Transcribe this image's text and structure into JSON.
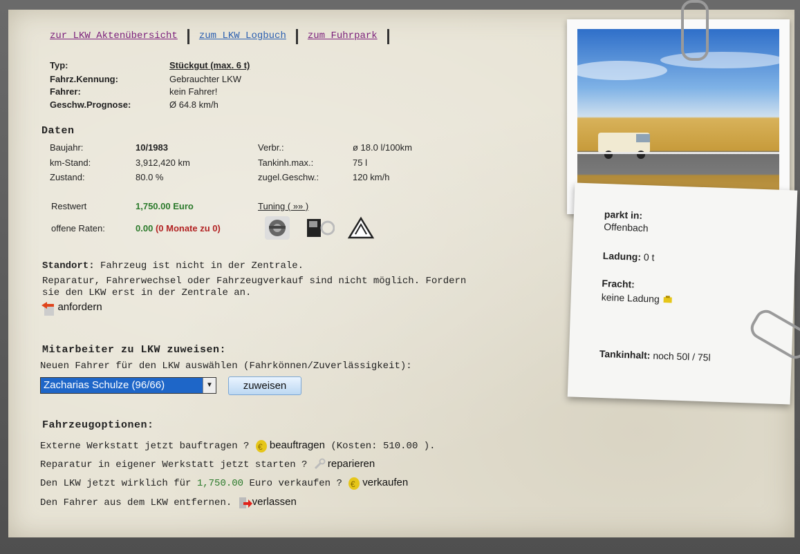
{
  "tabs": {
    "akten": "zur LKW Aktenübersicht",
    "logbuch": "zum LKW Logbuch",
    "fuhrpark": "zum Fuhrpark"
  },
  "info": {
    "typ_label": "Typ:",
    "typ_value": "Stückgut (max. 6 t)",
    "kennung_label": "Fahrz.Kennung:",
    "kennung_value": "Gebrauchter LKW",
    "fahrer_label": "Fahrer:",
    "fahrer_value": "kein Fahrer!",
    "prognose_label": "Geschw.Prognose:",
    "prognose_value": "Ø 64.8 km/h"
  },
  "daten": {
    "title": "Daten",
    "baujahr_label": "Baujahr:",
    "baujahr_value": "10/1983",
    "km_label": "km-Stand:",
    "km_value": "3,912,420 km",
    "zustand_label": "Zustand:",
    "zustand_value": "80.0 %",
    "verbr_label": "Verbr.:",
    "verbr_value": "ø 18.0 l/100km",
    "tank_label": "Tankinh.max.:",
    "tank_value": "75 l",
    "geschw_label": "zugel.Geschw.:",
    "geschw_value": "120 km/h",
    "restwert_label": "Restwert",
    "restwert_value": "1,750.00 Euro",
    "tuning_link": "Tuning ( »» )",
    "raten_label": "offene Raten:",
    "raten_value": "0.00",
    "raten_extra": "(0 Monate zu 0)"
  },
  "standort": {
    "title": "Standort:",
    "text1": "Fahrzeug ist nicht in der Zentrale.",
    "text2": "Reparatur, Fahrerwechsel oder Fahrzeugverkauf sind nicht möglich. Fordern",
    "text3": "sie den LKW erst in der Zentrale an.",
    "anfordern": "anfordern"
  },
  "mitarbeiter": {
    "title": "Mitarbeiter zu LKW zuweisen:",
    "hint": "Neuen Fahrer für den LKW auswählen (Fahrkönnen/Zuverlässigkeit):",
    "selected": "Zacharias Schulze (96/66)",
    "button": "zuweisen"
  },
  "optionen": {
    "title": "Fahrzeugoptionen:",
    "line1_text": "Externe Werkstatt jetzt bauftragen ?",
    "line1_link": "beauftragen",
    "line1_cost": "(Kosten: 510.00 ).",
    "line2_text": "Reparatur in eigener Werkstatt jetzt starten ?",
    "line2_link": "reparieren",
    "line3_text_a": "Den LKW jetzt wirklich für",
    "line3_amount": "1,750.00",
    "line3_text_b": "Euro verkaufen ?",
    "line3_link": "verkaufen",
    "line4_text": "Den Fahrer aus dem LKW entfernen.",
    "line4_link": "verlassen"
  },
  "note": {
    "parkt_label": "parkt in:",
    "parkt_value": "Offenbach",
    "ladung_label": "Ladung:",
    "ladung_value": "0 t",
    "fracht_label": "Fracht:",
    "fracht_value": "keine Ladung",
    "tank_label": "Tankinhalt:",
    "tank_value": "noch 50l / 75l"
  },
  "colors": {
    "accent_green": "#2b7a2b",
    "accent_red": "#b22222",
    "select_blue": "#1e66c8"
  },
  "icons": [
    "engine-icon",
    "truck-cab-icon",
    "road-sign-icon",
    "return-arrow-icon",
    "coin-icon",
    "wrench-icon",
    "exit-arrow-icon",
    "cargo-icon"
  ]
}
